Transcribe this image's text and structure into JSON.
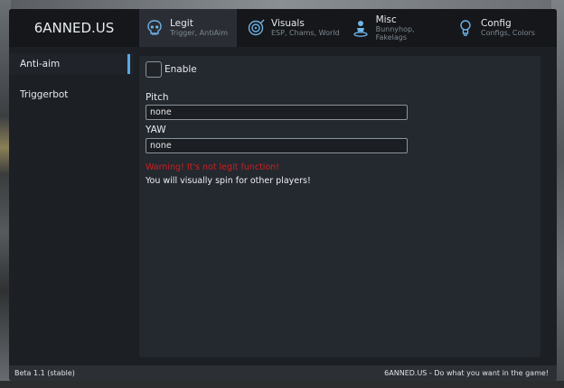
{
  "brand": "6ANNED.US",
  "tabs": [
    {
      "label": "Legit",
      "sub": "Trigger, AntiAim",
      "icon": "skull-icon"
    },
    {
      "label": "Visuals",
      "sub": "ESP, Chams, World",
      "icon": "target-icon"
    },
    {
      "label": "Misc",
      "sub": "Bunnyhop, Fakelags",
      "icon": "person-icon"
    },
    {
      "label": "Config",
      "sub": "Configs, Colors",
      "icon": "bulb-icon"
    }
  ],
  "sidebar": {
    "items": [
      {
        "label": "Anti-aim"
      },
      {
        "label": "Triggerbot"
      }
    ]
  },
  "content": {
    "enable_label": "Enable",
    "pitch_label": "Pitch",
    "pitch_value": "none",
    "yaw_label": "YAW",
    "yaw_value": "none",
    "warning": "Warning! It's not legit function!",
    "info": "You will visually spin for other players!"
  },
  "footer": {
    "left": "Beta 1.1 (stable)",
    "right": "6ANNED.US - Do what you want in the game!"
  },
  "colors": {
    "accent": "#5aa8e6",
    "warning": "#d11f1f",
    "window_bg": "#1c1f23",
    "panel_bg": "#24282f"
  }
}
